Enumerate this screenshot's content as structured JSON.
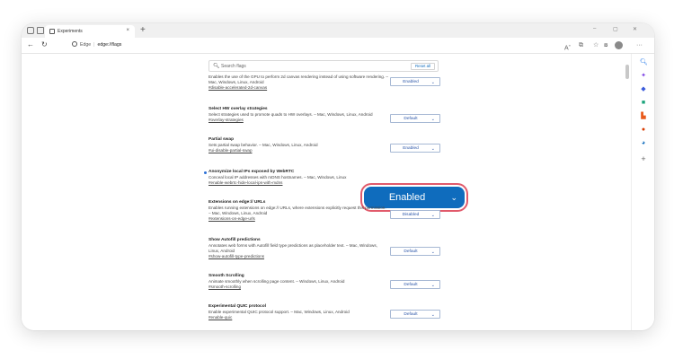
{
  "browser": {
    "tab_title": "Experiments",
    "tab_close": "×",
    "new_tab": "+",
    "address_label": "Edge",
    "address_url": "edge://flags",
    "window_controls": [
      "–",
      "▢",
      "✕"
    ]
  },
  "search": {
    "placeholder": "Search flags",
    "reset_label": "Reset all"
  },
  "flags": [
    {
      "name": "",
      "description": "Enables the use of the GPU to perform 2d canvas rendering instead of using software rendering. – Mac, Windows, Linux, Android",
      "link": "#disable-accelerated-2d-canvas",
      "value": "Enabled",
      "modified": false
    },
    {
      "name": "Select HW overlay strategies",
      "description": "Select strategies used to promote quads to HW overlays. – Mac, Windows, Linux, Android",
      "link": "#overlay-strategies",
      "value": "Default",
      "modified": false
    },
    {
      "name": "Partial swap",
      "description": "Sets partial swap behavior. – Mac, Windows, Linux, Android",
      "link": "#ui-disable-partial-swap",
      "value": "Enabled",
      "modified": false
    },
    {
      "name": "Anonymize local IPs exposed by WebRTC",
      "description": "Conceal local IP addresses with mDNS hostnames. – Mac, Windows, Linux",
      "link": "#enable-webrtc-hide-local-ips-with-mdns",
      "value": "Enabled",
      "modified": true
    },
    {
      "name": "Extensions on edge:// URLs",
      "description": "Enables running extensions on edge:// URLs, where extensions explicitly request this permission. – Mac, Windows, Linux, Android",
      "link": "#extensions-on-edge-urls",
      "value": "Disabled",
      "modified": false
    },
    {
      "name": "Show Autofill predictions",
      "description": "Annotates web forms with Autofill field type predictions as placeholder text. – Mac, Windows, Linux, Android",
      "link": "#show-autofill-type-predictions",
      "value": "Default",
      "modified": false
    },
    {
      "name": "Smooth Scrolling",
      "description": "Animate smoothly when scrolling page content. – Windows, Linux, Android",
      "link": "#smooth-scrolling",
      "value": "Default",
      "modified": false
    },
    {
      "name": "Experimental QUIC protocol",
      "description": "Enable experimental QUIC protocol support. – Mac, Windows, Linux, Android",
      "link": "#enable-quic",
      "value": "Default",
      "modified": false
    }
  ],
  "highlight": {
    "value": "Enabled",
    "chevron": "⌄",
    "ring_color": "#e15a6b",
    "fill_color": "#0f6cbd"
  },
  "sidebar_icons": [
    {
      "icon": "search-icon",
      "color": "#1a73e8"
    },
    {
      "icon": "sparkle-icon",
      "color": "#7b3fe4"
    },
    {
      "icon": "tag-icon",
      "color": "#3b5bdb"
    },
    {
      "icon": "briefcase-icon",
      "color": "#1aa37a"
    },
    {
      "icon": "office-icon",
      "color": "#e8591a"
    },
    {
      "icon": "outlook-icon",
      "color": "#d83b01"
    },
    {
      "icon": "send-icon",
      "color": "#0f6cbd"
    },
    {
      "icon": "add-icon",
      "color": "#666666"
    }
  ],
  "colors": {
    "accent": "#0f6cbd",
    "highlight_ring": "#e15a6b"
  }
}
